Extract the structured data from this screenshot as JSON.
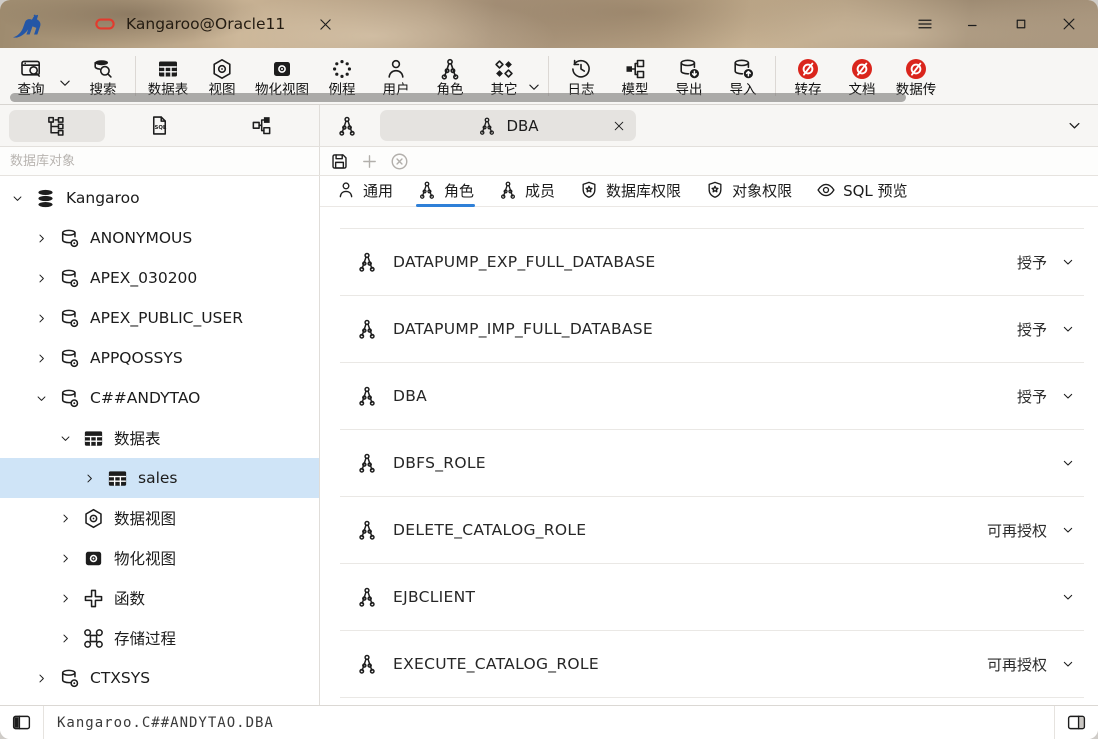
{
  "window": {
    "logo_icon": "kangaroo-logo",
    "title_tab": {
      "icon": "oracle-icon",
      "label": "Kangaroo@Oracle11",
      "close_icon": "close-icon"
    },
    "controls": {
      "menu_icon": "hamburger-menu-icon",
      "minimize_icon": "minimize-icon",
      "maximize_icon": "maximize-icon",
      "close_icon": "close-icon"
    }
  },
  "toolbar": {
    "items": [
      {
        "label": "查询",
        "icon": "query-search-icon",
        "has_dropdown": true
      },
      {
        "label": "搜索",
        "icon": "database-search-icon"
      },
      {
        "label": "数据表",
        "icon": "table-grid-icon"
      },
      {
        "label": "视图",
        "icon": "view-hexagon-eye-icon"
      },
      {
        "label": "物化视图",
        "icon": "materialized-view-icon"
      },
      {
        "label": "例程",
        "icon": "routine-dotted-circle-icon"
      },
      {
        "label": "用户",
        "icon": "user-icon"
      },
      {
        "label": "角色",
        "icon": "role-compass-icon"
      },
      {
        "label": "其它",
        "icon": "others-diamonds-icon",
        "has_dropdown": true
      },
      {
        "label": "日志",
        "icon": "history-clock-icon"
      },
      {
        "label": "模型",
        "icon": "model-orgchart-icon"
      },
      {
        "label": "导出",
        "icon": "database-export-icon"
      },
      {
        "label": "导入",
        "icon": "database-import-icon"
      },
      {
        "label": "转存",
        "icon": "disabled-red-icon",
        "accent": "#da251c"
      },
      {
        "label": "文档",
        "icon": "disabled-red-icon",
        "accent": "#da251c"
      },
      {
        "label": "数据传",
        "icon": "disabled-red-icon",
        "accent": "#da251c",
        "clipped": true
      }
    ]
  },
  "sidebar": {
    "tabs": [
      {
        "icon": "tree-icon",
        "active": true
      },
      {
        "icon": "sql-file-icon",
        "active": false
      },
      {
        "icon": "diagram-icon",
        "active": false
      }
    ],
    "filter_placeholder": "数据库对象",
    "tree": [
      {
        "label": "Kangaroo",
        "level": 0,
        "expanded": true,
        "icon": "database-stack-icon"
      },
      {
        "label": "ANONYMOUS",
        "level": 1,
        "expanded": false,
        "icon": "schema-icon"
      },
      {
        "label": "APEX_030200",
        "level": 1,
        "expanded": false,
        "icon": "schema-icon"
      },
      {
        "label": "APEX_PUBLIC_USER",
        "level": 1,
        "expanded": false,
        "icon": "schema-icon"
      },
      {
        "label": "APPQOSSYS",
        "level": 1,
        "expanded": false,
        "icon": "schema-icon"
      },
      {
        "label": "C##ANDYTAO",
        "level": 1,
        "expanded": true,
        "icon": "schema-icon"
      },
      {
        "label": "数据表",
        "level": 2,
        "expanded": true,
        "icon": "table-grid-icon"
      },
      {
        "label": "sales",
        "level": 3,
        "expanded": false,
        "icon": "table-grid-icon",
        "selected": true
      },
      {
        "label": "数据视图",
        "level": 2,
        "expanded": false,
        "icon": "view-hexagon-eye-icon"
      },
      {
        "label": "物化视图",
        "level": 2,
        "expanded": false,
        "icon": "materialized-view-icon"
      },
      {
        "label": "函数",
        "level": 2,
        "expanded": false,
        "icon": "function-icon"
      },
      {
        "label": "存储过程",
        "level": 2,
        "expanded": false,
        "icon": "stored-procedure-icon"
      },
      {
        "label": "CTXSYS",
        "level": 1,
        "expanded": false,
        "icon": "schema-icon"
      }
    ]
  },
  "main": {
    "doc_tab": {
      "icon": "role-compass-icon",
      "label": "DBA",
      "close_icon": "close-icon"
    },
    "actions": {
      "save_icon": "save-icon",
      "add_icon": "plus-icon",
      "cancel_icon": "cancel-circle-icon"
    },
    "tabs": [
      {
        "label": "通用",
        "icon": "user-icon",
        "active": false
      },
      {
        "label": "角色",
        "icon": "role-compass-icon",
        "active": true
      },
      {
        "label": "成员",
        "icon": "role-compass-icon",
        "active": false
      },
      {
        "label": "数据库权限",
        "icon": "shield-star-icon",
        "active": false
      },
      {
        "label": "对象权限",
        "icon": "shield-star-icon",
        "active": false
      },
      {
        "label": "SQL 预览",
        "icon": "eye-icon",
        "active": false
      }
    ],
    "roles": [
      {
        "name": "DATAPUMP_EXP_FULL_DATABASE",
        "grant": "授予"
      },
      {
        "name": "DATAPUMP_IMP_FULL_DATABASE",
        "grant": "授予"
      },
      {
        "name": "DBA",
        "grant": "授予"
      },
      {
        "name": "DBFS_ROLE",
        "grant": ""
      },
      {
        "name": "DELETE_CATALOG_ROLE",
        "grant": "可再授权"
      },
      {
        "name": "EJBCLIENT",
        "grant": ""
      },
      {
        "name": "EXECUTE_CATALOG_ROLE",
        "grant": "可再授权"
      }
    ]
  },
  "statusbar": {
    "path": "Kangaroo.C##ANDYTAO.DBA"
  },
  "colors": {
    "accent_blue": "#2f80d8",
    "selection": "#cfe4f7",
    "danger_red": "#da251c",
    "toolbar_bg": "#f7f6f4"
  }
}
